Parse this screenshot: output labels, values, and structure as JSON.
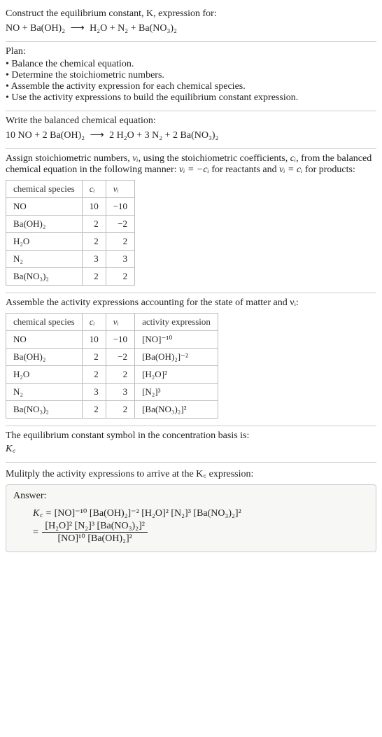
{
  "header": {
    "line1": "Construct the equilibrium constant, K, expression for:",
    "reaction_lhs": "NO + Ba(OH)₂",
    "arrow": "⟶",
    "reaction_rhs": "H₂O + N₂ + Ba(NO₃)₂"
  },
  "plan": {
    "title": "Plan:",
    "items": [
      "Balance the chemical equation.",
      "Determine the stoichiometric numbers.",
      "Assemble the activity expression for each chemical species.",
      "Use the activity expressions to build the equilibrium constant expression."
    ]
  },
  "balanced": {
    "title": "Write the balanced chemical equation:",
    "lhs": "10 NO + 2 Ba(OH)₂",
    "arrow": "⟶",
    "rhs": "2 H₂O + 3 N₂ + 2 Ba(NO₃)₂"
  },
  "stoich_intro": {
    "part1": "Assign stoichiometric numbers, ",
    "nu_i": "νᵢ",
    "part2": ", using the stoichiometric coefficients, ",
    "c_i": "cᵢ",
    "part3": ", from the balanced chemical equation in the following manner: ",
    "eq1": "νᵢ = −cᵢ",
    "part4": " for reactants and ",
    "eq2": "νᵢ = cᵢ",
    "part5": " for products:"
  },
  "stoich_table": {
    "headers": {
      "species": "chemical species",
      "ci": "cᵢ",
      "vi": "νᵢ"
    },
    "rows": [
      {
        "species": "NO",
        "ci": "10",
        "vi": "−10"
      },
      {
        "species": "Ba(OH)₂",
        "ci": "2",
        "vi": "−2"
      },
      {
        "species": "H₂O",
        "ci": "2",
        "vi": "2"
      },
      {
        "species": "N₂",
        "ci": "3",
        "vi": "3"
      },
      {
        "species": "Ba(NO₃)₂",
        "ci": "2",
        "vi": "2"
      }
    ]
  },
  "activity_intro": "Assemble the activity expressions accounting for the state of matter and νᵢ:",
  "activity_table": {
    "headers": {
      "species": "chemical species",
      "ci": "cᵢ",
      "vi": "νᵢ",
      "expr": "activity expression"
    },
    "rows": [
      {
        "species": "NO",
        "ci": "10",
        "vi": "−10",
        "expr": "[NO]⁻¹⁰"
      },
      {
        "species": "Ba(OH)₂",
        "ci": "2",
        "vi": "−2",
        "expr": "[Ba(OH)₂]⁻²"
      },
      {
        "species": "H₂O",
        "ci": "2",
        "vi": "2",
        "expr": "[H₂O]²"
      },
      {
        "species": "N₂",
        "ci": "3",
        "vi": "3",
        "expr": "[N₂]³"
      },
      {
        "species": "Ba(NO₃)₂",
        "ci": "2",
        "vi": "2",
        "expr": "[Ba(NO₃)₂]²"
      }
    ]
  },
  "kc_symbol": {
    "line": "The equilibrium constant symbol in the concentration basis is:",
    "symbol": "K꜀"
  },
  "multiply_line": "Mulitply the activity expressions to arrive at the K꜀ expression:",
  "answer": {
    "label": "Answer:",
    "kc_prefix": "K꜀ = ",
    "flat": "[NO]⁻¹⁰ [Ba(OH)₂]⁻² [H₂O]² [N₂]³ [Ba(NO₃)₂]²",
    "eq": "= ",
    "frac_num": "[H₂O]² [N₂]³ [Ba(NO₃)₂]²",
    "frac_den": "[NO]¹⁰ [Ba(OH)₂]²"
  }
}
